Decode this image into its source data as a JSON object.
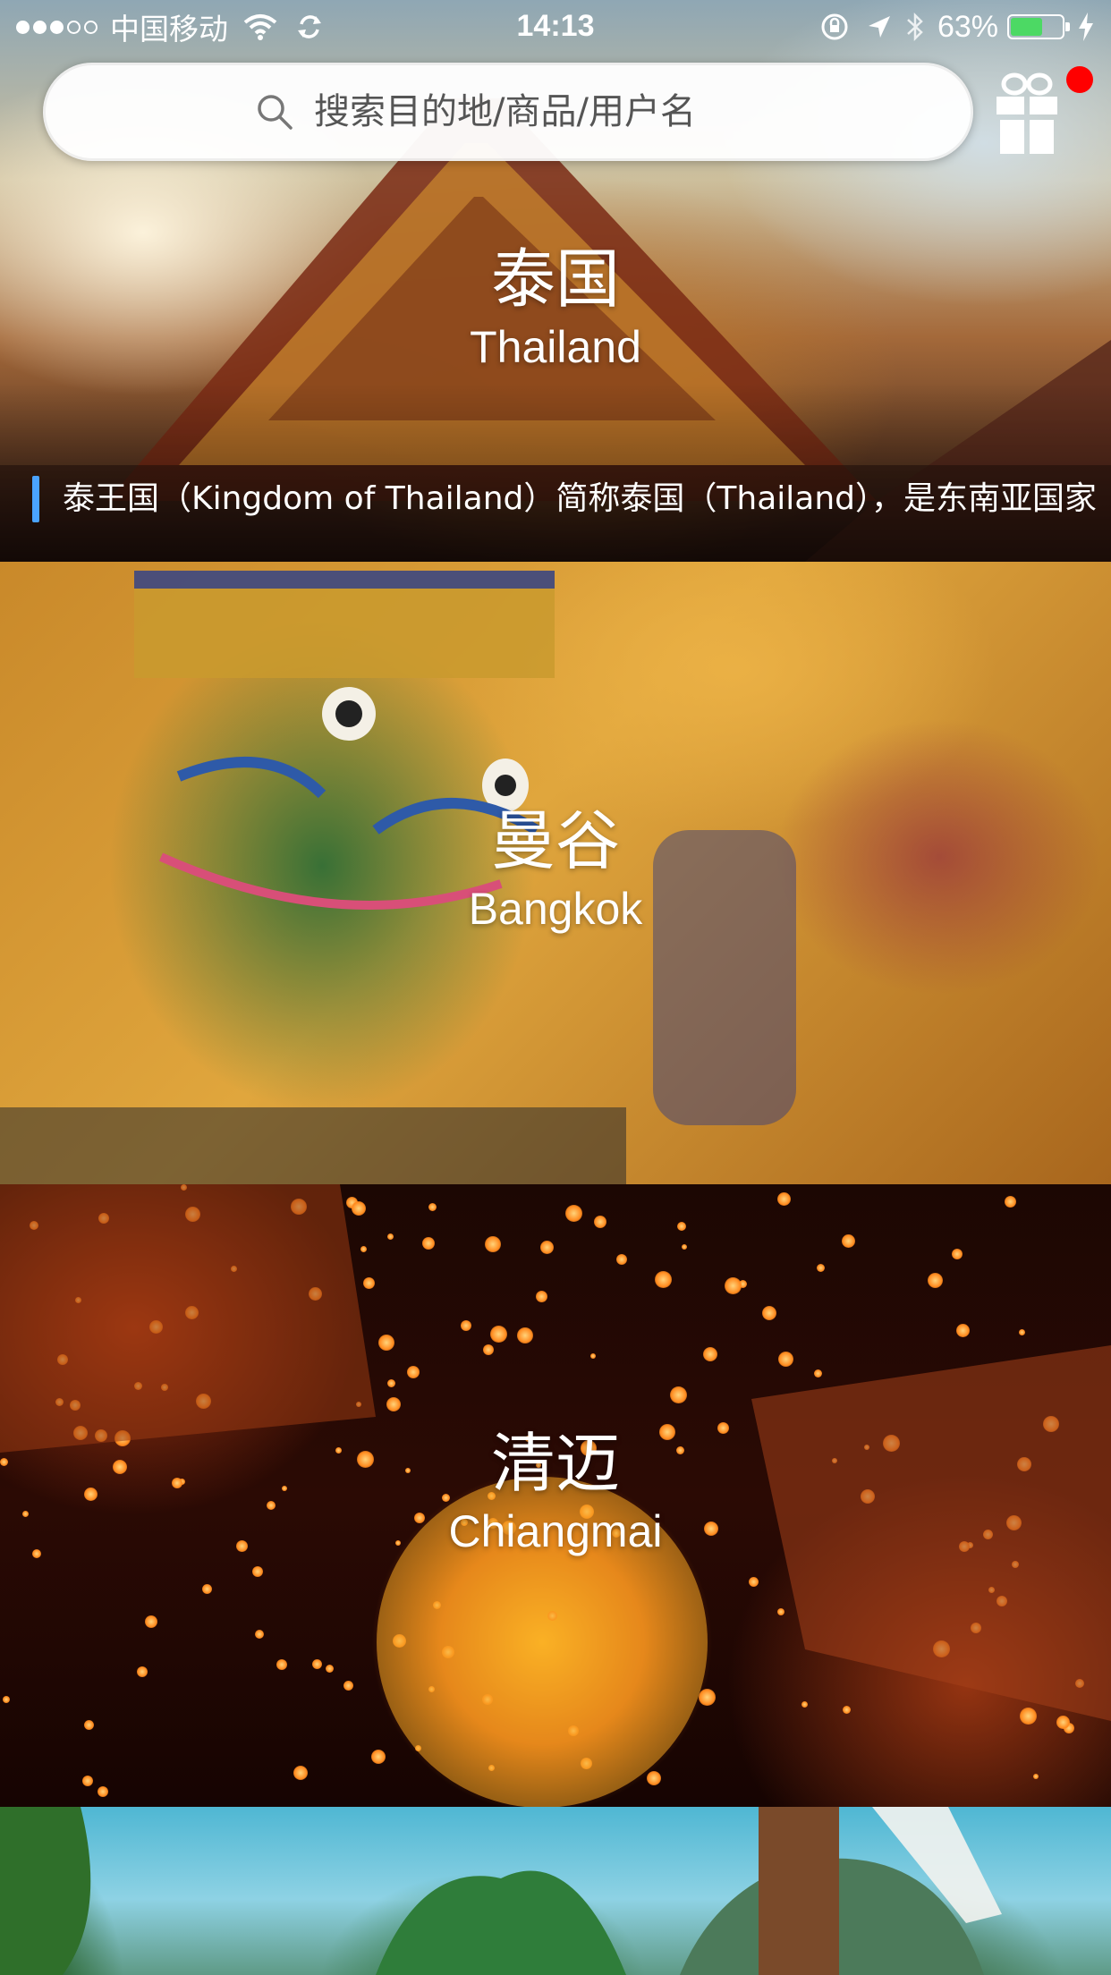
{
  "status_bar": {
    "carrier": "中国移动",
    "time": "14:13",
    "battery": "63%",
    "battery_level": 0.63,
    "signal_bars_filled": 3,
    "signal_bars_total": 5
  },
  "search": {
    "placeholder": "搜索目的地/商品/用户名"
  },
  "gift": {
    "icon": "gift-icon",
    "badge_color": "#ff0000"
  },
  "destinations": [
    {
      "name_zh": "泰国",
      "name_en": "Thailand",
      "description": "泰王国（Kingdom of Thailand）简称泰国（Thailand），是东南亚国家"
    },
    {
      "name_zh": "曼谷",
      "name_en": "Bangkok"
    },
    {
      "name_zh": "清迈",
      "name_en": "Chiangmai"
    }
  ],
  "colors": {
    "accent_bar": "#4aa3ff",
    "battery_fill": "#4cd964"
  }
}
